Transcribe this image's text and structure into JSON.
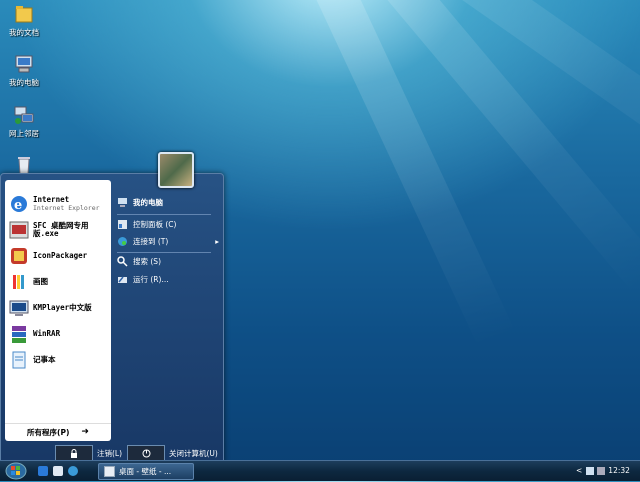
{
  "desktop": {
    "icons": [
      {
        "label": "我的文档",
        "icon": "folder-icon"
      },
      {
        "label": "我的电脑",
        "icon": "computer-icon"
      },
      {
        "label": "网上邻居",
        "icon": "network-icon"
      },
      {
        "label": "",
        "icon": "recycle-bin-icon"
      }
    ]
  },
  "start_menu": {
    "pinned": [
      {
        "title": "Internet",
        "subtitle": "Internet Explorer",
        "icon": "ie-icon"
      },
      {
        "title": "SFC 桌酷网专用版.exe",
        "subtitle": "",
        "icon": "sfc-icon"
      },
      {
        "title": "IconPackager",
        "subtitle": "",
        "icon": "iconpackager-icon"
      },
      {
        "title": "画图",
        "subtitle": "",
        "icon": "paint-icon"
      },
      {
        "title": "KMPlayer中文版",
        "subtitle": "",
        "icon": "kmplayer-icon"
      },
      {
        "title": "WinRAR",
        "subtitle": "",
        "icon": "winrar-icon"
      },
      {
        "title": "记事本",
        "subtitle": "",
        "icon": "notepad-icon"
      }
    ],
    "all_programs": "所有程序(P)",
    "all_programs_arrow": "➜",
    "right_items": [
      {
        "label": "我的电脑",
        "icon": "computer-icon"
      },
      {
        "label": "控制面板 (C)",
        "icon": "control-panel-icon"
      },
      {
        "label": "连接到 (T)",
        "icon": "connect-icon",
        "arrow": "▸"
      },
      {
        "label": "搜索 (S)",
        "icon": "search-icon"
      },
      {
        "label": "运行 (R)...",
        "icon": "run-icon"
      }
    ],
    "logoff_label": "注销(L)",
    "shutdown_label": "关闭计算机(U)"
  },
  "taskbar": {
    "task_label": "桌面 - 壁纸 - ...",
    "tray_arrow": "<",
    "clock": "12:32"
  }
}
